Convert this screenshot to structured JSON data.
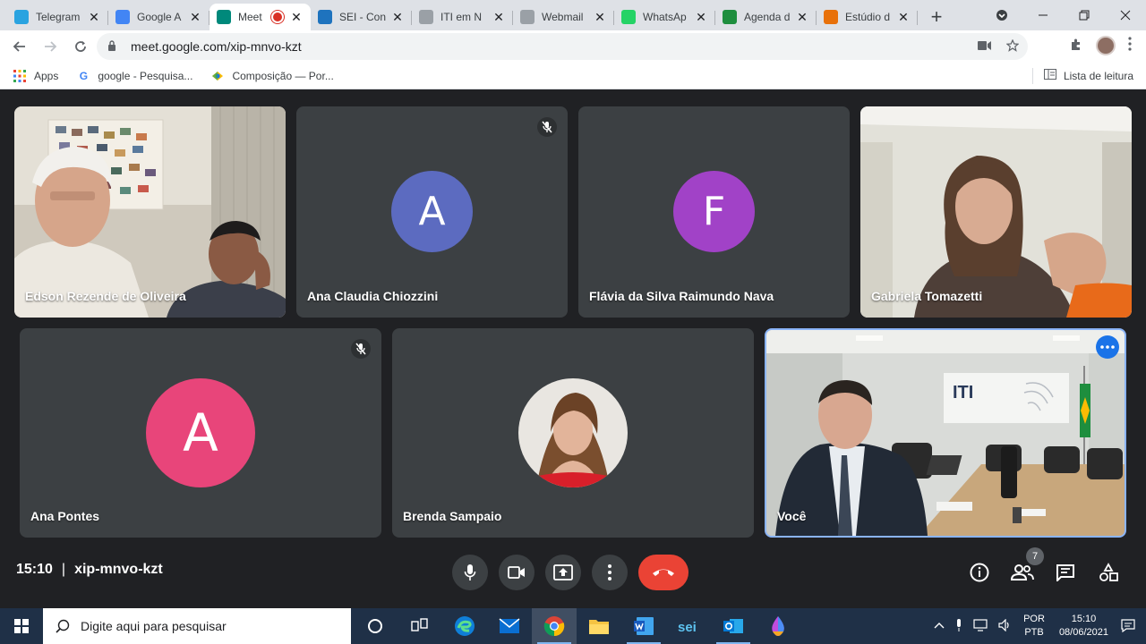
{
  "browser": {
    "tabs": [
      {
        "title": "Telegram",
        "icon": "telegram-icon",
        "color": "#2aa3e0"
      },
      {
        "title": "Google A",
        "icon": "google-admin-icon",
        "color": "#4285f4"
      },
      {
        "title": "Meet",
        "icon": "meet-icon",
        "color": "#00897b",
        "active": true
      },
      {
        "title": "SEI - Con",
        "icon": "sei-icon",
        "color": "#1e73be"
      },
      {
        "title": "ITI em N",
        "icon": "fingerprint-icon",
        "color": "#9aa0a6"
      },
      {
        "title": "Webmail",
        "icon": "webmail-icon",
        "color": "#9aa0a6"
      },
      {
        "title": "WhatsAp",
        "icon": "whatsapp-icon",
        "color": "#25d366"
      },
      {
        "title": "Agenda d",
        "icon": "gov-br-icon",
        "color": "#1e8e3e"
      },
      {
        "title": "Estúdio d",
        "icon": "estudio-icon",
        "color": "#e8710a"
      }
    ],
    "url": "meet.google.com/xip-mnvo-kzt",
    "bookmarks": [
      {
        "label": "Apps",
        "icon": "apps-grid-icon"
      },
      {
        "label": "google - Pesquisa...",
        "icon": "google-icon"
      },
      {
        "label": "Composição — Por...",
        "icon": "gov-br-icon"
      }
    ],
    "reading_list": "Lista de leitura"
  },
  "meet": {
    "participants": [
      {
        "name": "Edson Rezende de Oliveira",
        "type": "video",
        "muted": false
      },
      {
        "name": "Ana Claudia Chiozzini",
        "type": "avatar",
        "initial": "A",
        "color": "#5c6bc0",
        "muted": true
      },
      {
        "name": "Flávia da Silva Raimundo Nava",
        "type": "avatar",
        "initial": "F",
        "color": "#a142c7",
        "muted": false
      },
      {
        "name": "Gabriela Tomazetti",
        "type": "video",
        "muted": false
      },
      {
        "name": "Ana Pontes",
        "type": "avatar",
        "initial": "A",
        "color": "#e8457a",
        "muted": true
      },
      {
        "name": "Brenda Sampaio",
        "type": "photo",
        "muted": false
      },
      {
        "name": "Você",
        "type": "video",
        "muted": false,
        "self": true
      }
    ],
    "time": "15:10",
    "meeting_code": "xip-mnvo-kzt",
    "participant_count": "7",
    "self_video_sign": "ITI"
  },
  "taskbar": {
    "search_placeholder": "Digite aqui para pesquisar",
    "lang_top": "POR",
    "lang_bottom": "PTB",
    "time": "15:10",
    "date": "08/06/2021",
    "pinned_apps": [
      "cortana-icon",
      "task-view-icon",
      "edge-icon",
      "mail-icon",
      "chrome-icon",
      "file-explorer-icon",
      "word-icon",
      "sei-icon",
      "outlook-icon",
      "paint-drop-icon"
    ]
  }
}
